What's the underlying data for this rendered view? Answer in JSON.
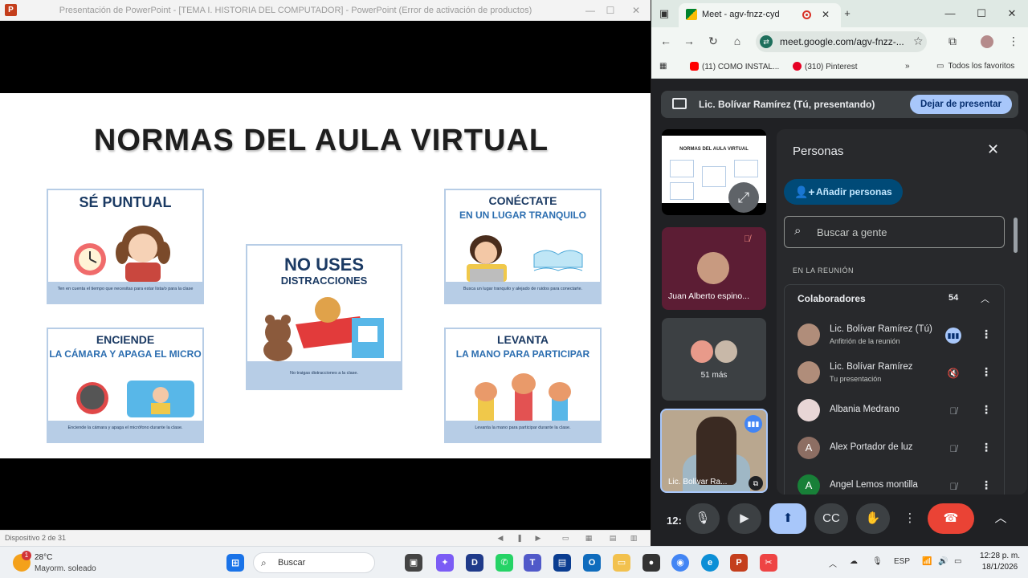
{
  "powerpoint": {
    "window_title": "Presentación de PowerPoint - [TEMA I. HISTORIA DEL COMPUTADOR] - PowerPoint (Error de activación de productos)",
    "status_slide": "Dispositivo 2 de 31",
    "slide": {
      "title": "NORMAS DEL AULA VIRTUAL",
      "cards": [
        {
          "title_big": "SÉ PUNTUAL",
          "title_small": "",
          "caption": "Ten en cuenta el tiempo que necesitas para estar lista/o para la clase"
        },
        {
          "title_big": "NO USES",
          "title_small": "DISTRACCIONES",
          "caption": "No traigas distracciones a la clase."
        },
        {
          "title_big": "CONÉCTATE",
          "title_small": "EN UN LUGAR TRANQUILO",
          "caption": "Busca un lugar tranquilo y alejado de ruidos para conectarte."
        },
        {
          "title_big": "ENCIENDE",
          "title_small": "LA CÁMARA Y APAGA EL MICRO",
          "caption": "Enciende la cámara y apaga el micrófono durante la clase."
        },
        {
          "title_big": "LEVANTA",
          "title_small": "LA MANO PARA PARTICIPAR",
          "caption": "Levanta la mano para participar durante la clase."
        }
      ]
    }
  },
  "chrome": {
    "tab_title": "Meet - agv-fnzz-cyd",
    "url": "meet.google.com/agv-fnzz-...",
    "bookmarks": [
      {
        "label": "(11) COMO INSTAL..."
      },
      {
        "label": "(310) Pinterest"
      }
    ],
    "bookmarks_all": "Todos los favoritos"
  },
  "meet": {
    "presenting_text": "Lic. Bolívar Ramírez (Tú, presentando)",
    "stop_presenting": "Dejar de presentar",
    "slide_thumb_title": "NORMAS DEL AULA VIRTUAL",
    "tiles": {
      "juan": "Juan Alberto espino...",
      "more": "51 más",
      "self": "Lic. Bolívar Ra..."
    },
    "panel": {
      "title": "Personas",
      "add_people": "Añadir personas",
      "search_placeholder": "Buscar a gente",
      "section": "EN LA REUNIÓN",
      "group": "Colaboradores",
      "group_count": "54",
      "people": [
        {
          "name": "Lic. Bolívar Ramírez (Tú)",
          "sub": "Anfitrión de la reunión",
          "initial": "",
          "color": "#b08d7a"
        },
        {
          "name": "Lic. Bolívar Ramírez",
          "sub": "Tu presentación",
          "initial": "",
          "color": "#b08d7a"
        },
        {
          "name": "Albania Medrano",
          "sub": "",
          "initial": "",
          "color": "#e8d6d6"
        },
        {
          "name": "Alex Portador de luz",
          "sub": "",
          "initial": "A",
          "color": "#8d6e63"
        },
        {
          "name": "Angel Lemos montilla",
          "sub": "",
          "initial": "A",
          "color": "#188038"
        }
      ]
    },
    "time": "12:"
  },
  "taskbar": {
    "weather_temp": "28°C",
    "weather_desc": "Mayorm. soleado",
    "weather_badge": "1",
    "search_label": "Buscar",
    "lang": "ESP",
    "time": "12:28 p. m.",
    "date": "18/1/2026"
  }
}
